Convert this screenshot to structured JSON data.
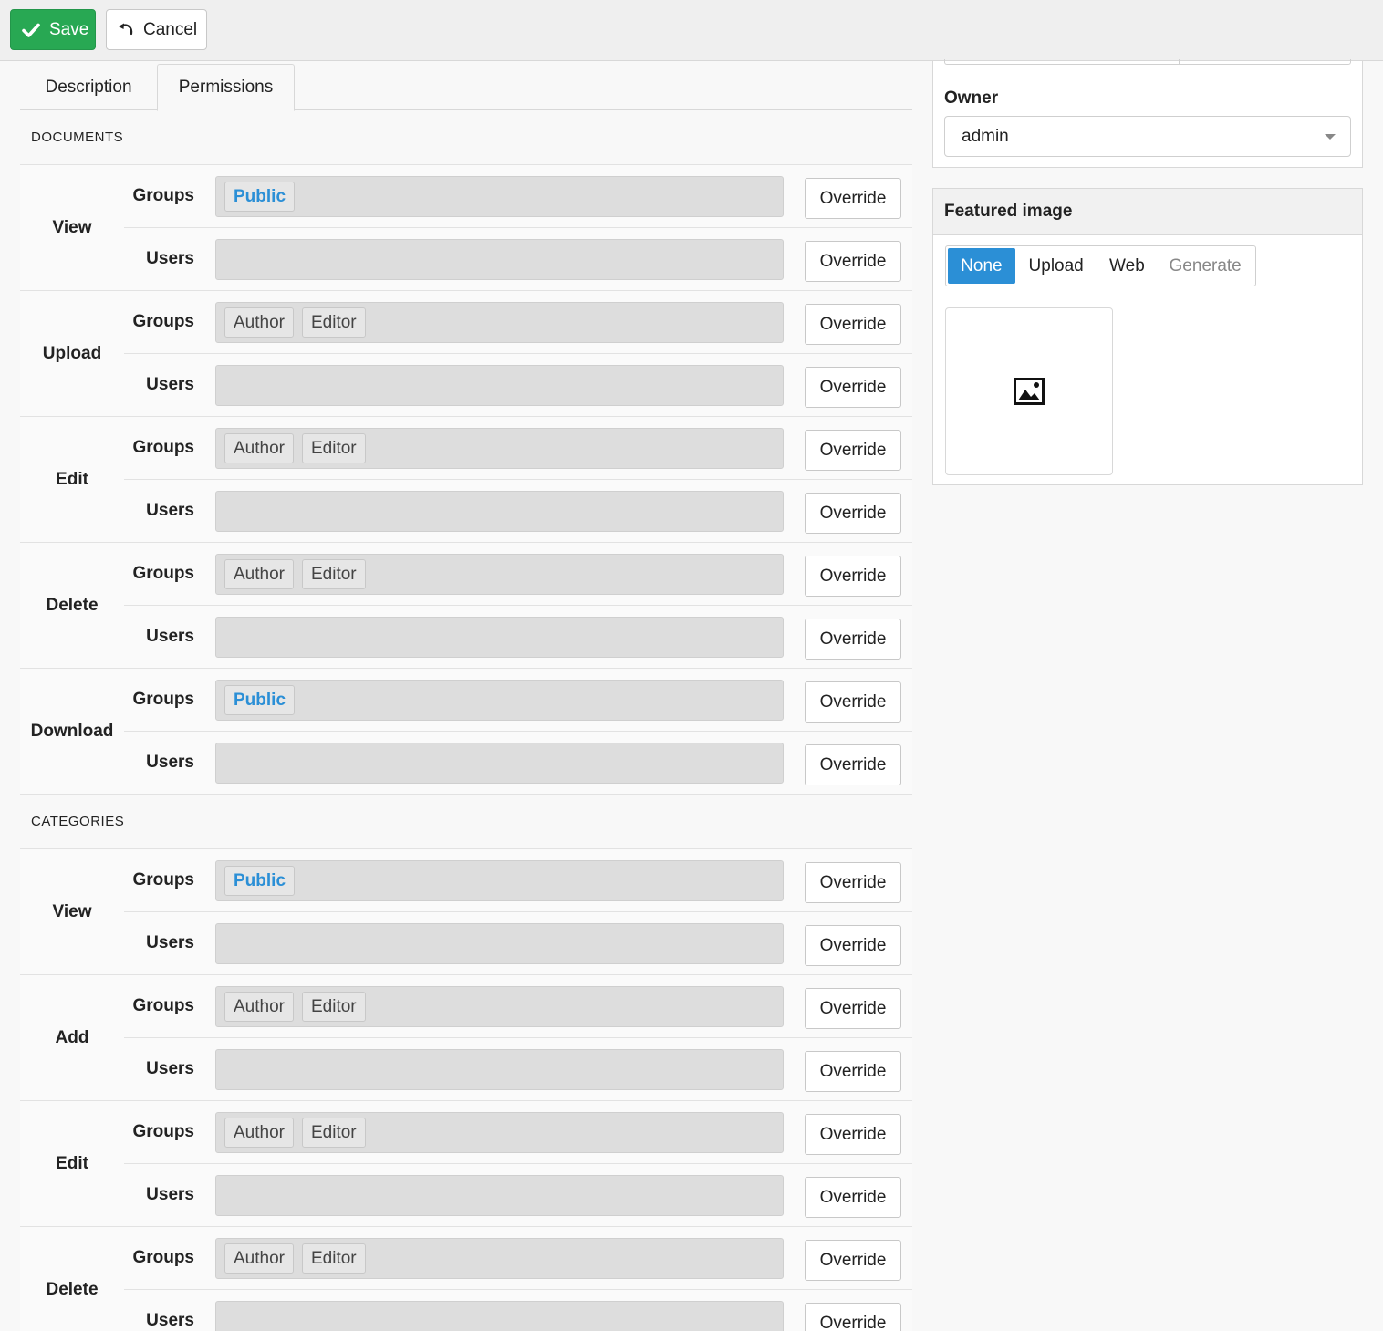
{
  "toolbar": {
    "save_label": "Save",
    "cancel_label": "Cancel"
  },
  "tabs": [
    {
      "label": "Description"
    },
    {
      "label": "Permissions"
    }
  ],
  "sections": [
    {
      "title": "DOCUMENTS",
      "actions": [
        {
          "label": "View",
          "rows": [
            {
              "label": "Groups",
              "tags": [
                {
                  "text": "Public",
                  "kind": "link"
                }
              ],
              "button": "Override"
            },
            {
              "label": "Users",
              "tags": [],
              "button": "Override"
            }
          ]
        },
        {
          "label": "Upload",
          "rows": [
            {
              "label": "Groups",
              "tags": [
                {
                  "text": "Author"
                },
                {
                  "text": "Editor"
                }
              ],
              "button": "Override"
            },
            {
              "label": "Users",
              "tags": [],
              "button": "Override"
            }
          ]
        },
        {
          "label": "Edit",
          "rows": [
            {
              "label": "Groups",
              "tags": [
                {
                  "text": "Author"
                },
                {
                  "text": "Editor"
                }
              ],
              "button": "Override"
            },
            {
              "label": "Users",
              "tags": [],
              "button": "Override"
            }
          ]
        },
        {
          "label": "Delete",
          "rows": [
            {
              "label": "Groups",
              "tags": [
                {
                  "text": "Author"
                },
                {
                  "text": "Editor"
                }
              ],
              "button": "Override"
            },
            {
              "label": "Users",
              "tags": [],
              "button": "Override"
            }
          ]
        },
        {
          "label": "Download",
          "rows": [
            {
              "label": "Groups",
              "tags": [
                {
                  "text": "Public",
                  "kind": "link"
                }
              ],
              "button": "Override"
            },
            {
              "label": "Users",
              "tags": [],
              "button": "Override"
            }
          ]
        }
      ]
    },
    {
      "title": "CATEGORIES",
      "actions": [
        {
          "label": "View",
          "rows": [
            {
              "label": "Groups",
              "tags": [
                {
                  "text": "Public",
                  "kind": "link"
                }
              ],
              "button": "Override"
            },
            {
              "label": "Users",
              "tags": [],
              "button": "Override"
            }
          ]
        },
        {
          "label": "Add",
          "rows": [
            {
              "label": "Groups",
              "tags": [
                {
                  "text": "Author"
                },
                {
                  "text": "Editor"
                }
              ],
              "button": "Override"
            },
            {
              "label": "Users",
              "tags": [],
              "button": "Override"
            }
          ]
        },
        {
          "label": "Edit",
          "rows": [
            {
              "label": "Groups",
              "tags": [
                {
                  "text": "Author"
                },
                {
                  "text": "Editor"
                }
              ],
              "button": "Override"
            },
            {
              "label": "Users",
              "tags": [],
              "button": "Override"
            }
          ]
        },
        {
          "label": "Delete",
          "rows": [
            {
              "label": "Groups",
              "tags": [
                {
                  "text": "Author"
                },
                {
                  "text": "Editor"
                }
              ],
              "button": "Override"
            },
            {
              "label": "Users",
              "tags": [],
              "button": "Override"
            }
          ]
        }
      ]
    }
  ],
  "sidebar": {
    "owner": {
      "label": "Owner",
      "value": "admin"
    },
    "featured_image": {
      "title": "Featured image",
      "options": [
        "None",
        "Upload",
        "Web",
        "Generate"
      ],
      "selected": "None",
      "preview_icon": "image-icon"
    }
  },
  "colors": {
    "save": "#28a853",
    "accent": "#2b8fd6"
  }
}
